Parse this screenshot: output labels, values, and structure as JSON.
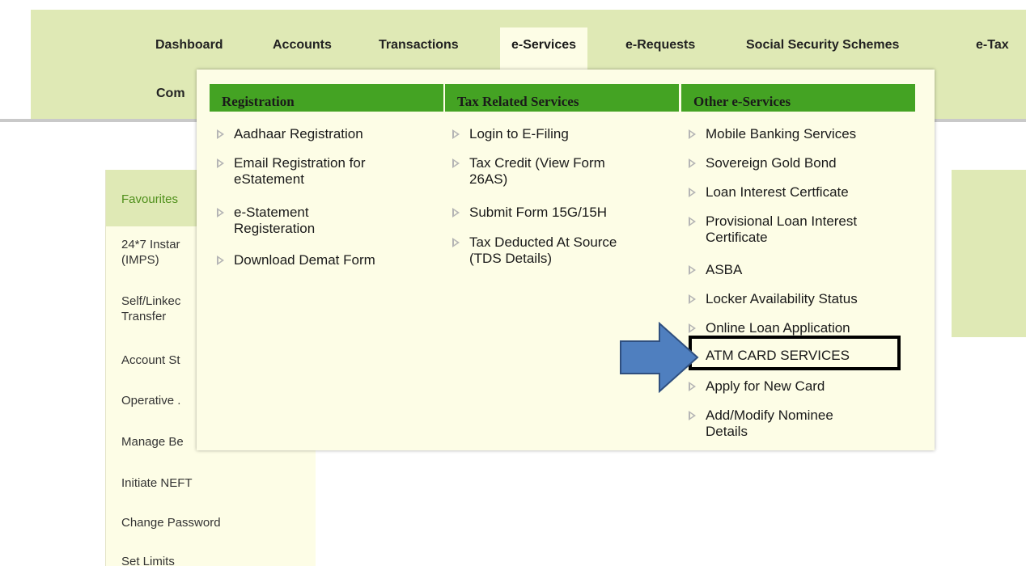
{
  "nav": {
    "items": [
      "Dashboard",
      "Accounts",
      "Transactions",
      "e-Services",
      "e-Requests",
      "Social Security Schemes",
      "e-Tax"
    ],
    "row2_item": "Com",
    "active": "e-Services"
  },
  "favourites": {
    "header": "Favourites",
    "items": [
      [
        "24*7 Instar",
        "(IMPS)"
      ],
      [
        "Self/Linkec",
        "Transfer"
      ],
      [
        "Account St"
      ],
      [
        "Operative ."
      ],
      [
        "Manage Be"
      ],
      [
        "Initiate NEFT"
      ],
      [
        "Change Password"
      ],
      [
        "Set Limits"
      ]
    ]
  },
  "menu": {
    "columns": [
      {
        "title": "Registration",
        "items": [
          [
            "Aadhaar Registration"
          ],
          [
            "Email Registration for",
            "eStatement"
          ],
          [
            "e-Statement",
            "Registeration"
          ],
          [
            "Download Demat Form"
          ]
        ]
      },
      {
        "title": "Tax Related Services",
        "items": [
          [
            "Login to E-Filing"
          ],
          [
            "Tax Credit (View Form",
            "26AS)"
          ],
          [
            "Submit Form 15G/15H"
          ],
          [
            "Tax Deducted At Source",
            "(TDS Details)"
          ]
        ]
      },
      {
        "title": "Other e-Services",
        "items": [
          [
            "Mobile Banking Services"
          ],
          [
            "Sovereign Gold Bond"
          ],
          [
            "Loan Interest Certficate"
          ],
          [
            "Provisional Loan Interest",
            "Certificate"
          ],
          [
            "ASBA"
          ],
          [
            "Locker Availability Status"
          ],
          [
            "Online Loan Application"
          ],
          [
            "ATM CARD SERVICES"
          ],
          [
            "Apply for New Card"
          ],
          [
            "Add/Modify Nominee",
            "Details"
          ]
        ]
      }
    ],
    "highlighted_item": "ATM CARD SERVICES"
  },
  "colors": {
    "nav_band": "#dfe9b5",
    "menu_bg": "#fdfde6",
    "header_green": "#44a323",
    "favourites_text": "#4e8f1a",
    "arrow_fill": "#4f7fbf",
    "arrow_stroke": "#2f4f7f",
    "highlight_border": "#000000"
  }
}
